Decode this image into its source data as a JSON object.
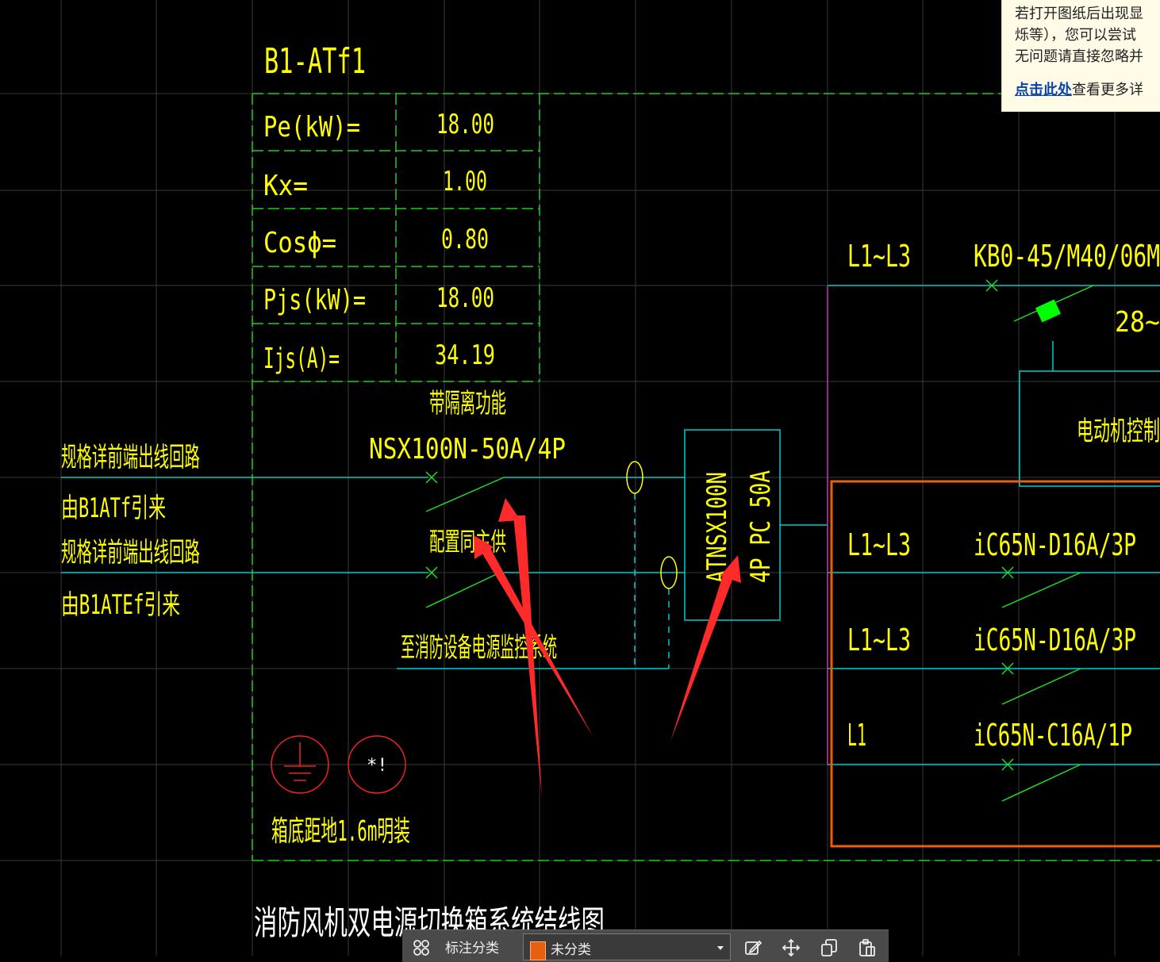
{
  "drawing": {
    "box_id": "B1-ATf1",
    "diagram_title": "消防风机双电源切换箱系统结线图",
    "load_table": [
      {
        "label": "Pe(kW)=",
        "value": "18.00"
      },
      {
        "label": "Kx=",
        "value": "1.00"
      },
      {
        "label": "Cosϕ=",
        "value": "0.80"
      },
      {
        "label": "Pjs(kW)=",
        "value": "18.00"
      },
      {
        "label": "Ijs(A)=",
        "value": "34.19"
      }
    ],
    "incoming": {
      "line1_note": "规格详前端出线回路",
      "line1_source": "由B1ATf引来",
      "line2_note": "规格详前端出线回路",
      "line2_source": "由B1ATEf引来"
    },
    "main_breaker": {
      "note": "带隔离功能",
      "model": "NSX100N-50A/4P",
      "aux_note": "配置同主供",
      "monitor_note": "至消防设备电源监控系统"
    },
    "ats": {
      "line1": "ATNSX100N",
      "line2": "4P PC 50A"
    },
    "outgoing": [
      {
        "phase": "L1~L3",
        "device": "KB0-45/M40/06M"
      },
      {
        "phase": "L1~L3",
        "device": "iC65N-D16A/3P"
      },
      {
        "phase": "L1~L3",
        "device": "iC65N-D16A/3P"
      },
      {
        "phase": "L1",
        "device": "iC65N-C16A/1P"
      }
    ],
    "motor_note_partial": "28~",
    "motor_box": "电动机控制",
    "mount_note": "箱底距地1.6m明装",
    "symbol_marks": {
      "explosion": "*!"
    }
  },
  "notice": {
    "line1": "若打开图纸后出现显",
    "line2": "烁等），您可以尝试",
    "line3": "无问题请直接忽略并",
    "link": "点击此处",
    "link_tail": "查看更多详"
  },
  "toolbar": {
    "category_label": "标注分类",
    "selected_category": "未分类"
  },
  "colors": {
    "background": "#000000",
    "text": "#ffff00",
    "table_border": "#22cc22",
    "wire": "#00cccc",
    "breaker": "#22dd22",
    "frame": "#e85f0f",
    "annotation_arrow": "#ff2a2a",
    "grid": "#3a3a3a"
  }
}
